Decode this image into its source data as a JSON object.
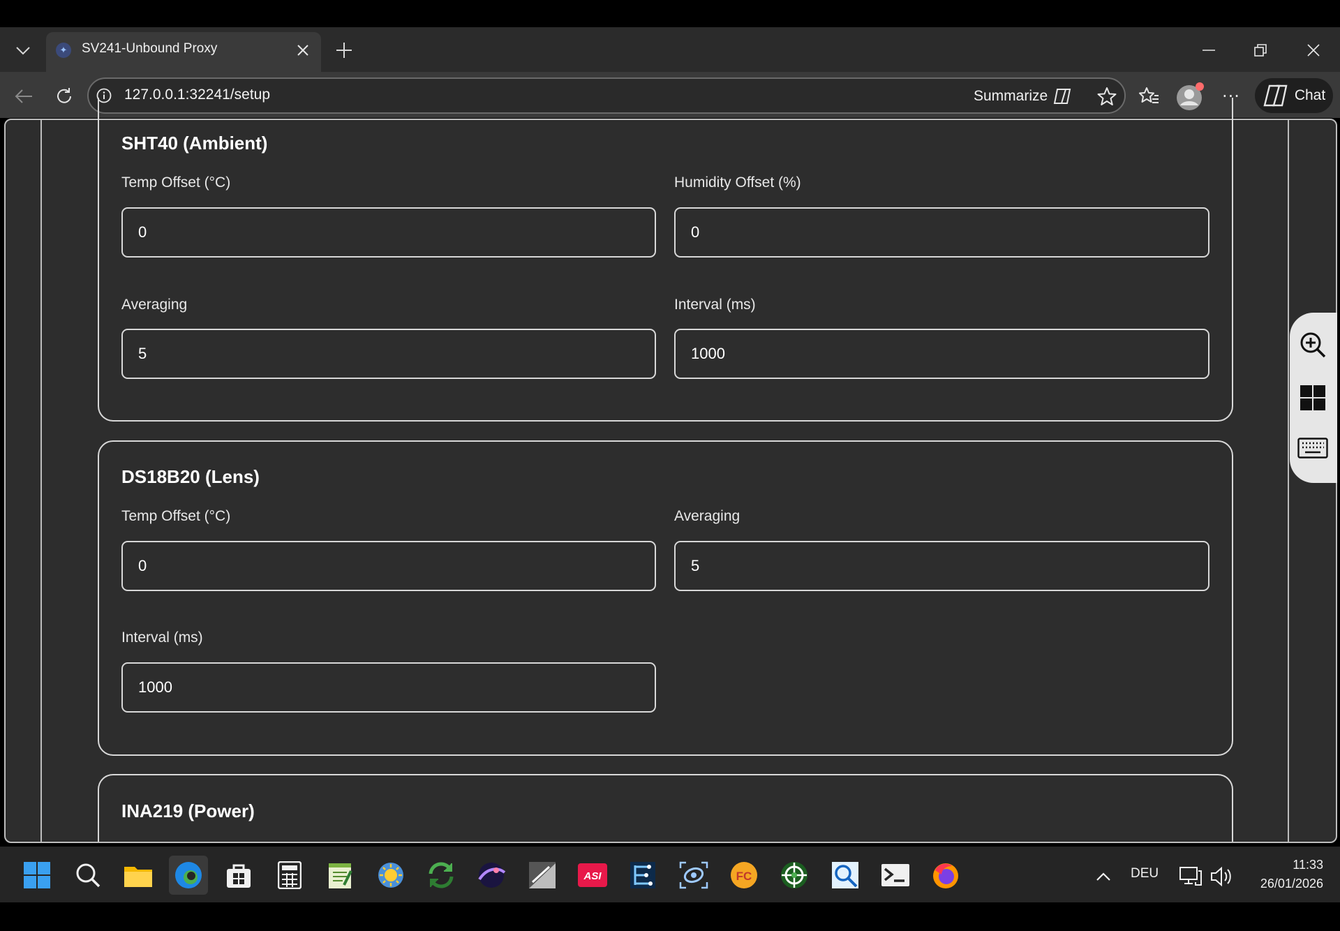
{
  "browser": {
    "tab": {
      "title": "SV241-Unbound Proxy",
      "favicon": "proxy-favicon-icon"
    },
    "url": "127.0.0.1:32241/setup",
    "summarize_label": "Summarize",
    "chat_label": "Chat"
  },
  "page": {
    "sections": [
      {
        "title": "SHT40 (Ambient)",
        "fields": [
          {
            "label": "Temp Offset (°C)",
            "value": "0"
          },
          {
            "label": "Humidity Offset (%)",
            "value": "0"
          },
          {
            "label": "Averaging",
            "value": "5"
          },
          {
            "label": "Interval (ms)",
            "value": "1000"
          }
        ]
      },
      {
        "title": "DS18B20 (Lens)",
        "fields": [
          {
            "label": "Temp Offset (°C)",
            "value": "0"
          },
          {
            "label": "Averaging",
            "value": "5"
          },
          {
            "label": "Interval (ms)",
            "value": "1000"
          }
        ]
      },
      {
        "title": "INA219 (Power)",
        "fields": []
      }
    ]
  },
  "side_panel": {
    "items": [
      "zoom-in-icon",
      "grid-icon",
      "keyboard-icon"
    ]
  },
  "taskbar": {
    "apps": [
      "windows-start-icon",
      "search-icon",
      "file-explorer-icon",
      "edge-icon",
      "store-icon",
      "calculator-icon",
      "notepad-icon",
      "weather-app-icon",
      "sync-icon",
      "astro-app-icon",
      "image-app-icon",
      "asi-icon",
      "chart-app-icon",
      "camera-app-icon",
      "fc-icon",
      "target-app-icon",
      "search-app-icon",
      "terminal-icon",
      "firefox-icon"
    ],
    "language": "DEU",
    "time": "11:33",
    "date": "26/01/2026"
  },
  "colors": {
    "page_bg": "#2d2d2d",
    "border": "#d8d8d8",
    "chrome_bg": "#3a3a3a",
    "taskbar_bg": "#252525"
  }
}
